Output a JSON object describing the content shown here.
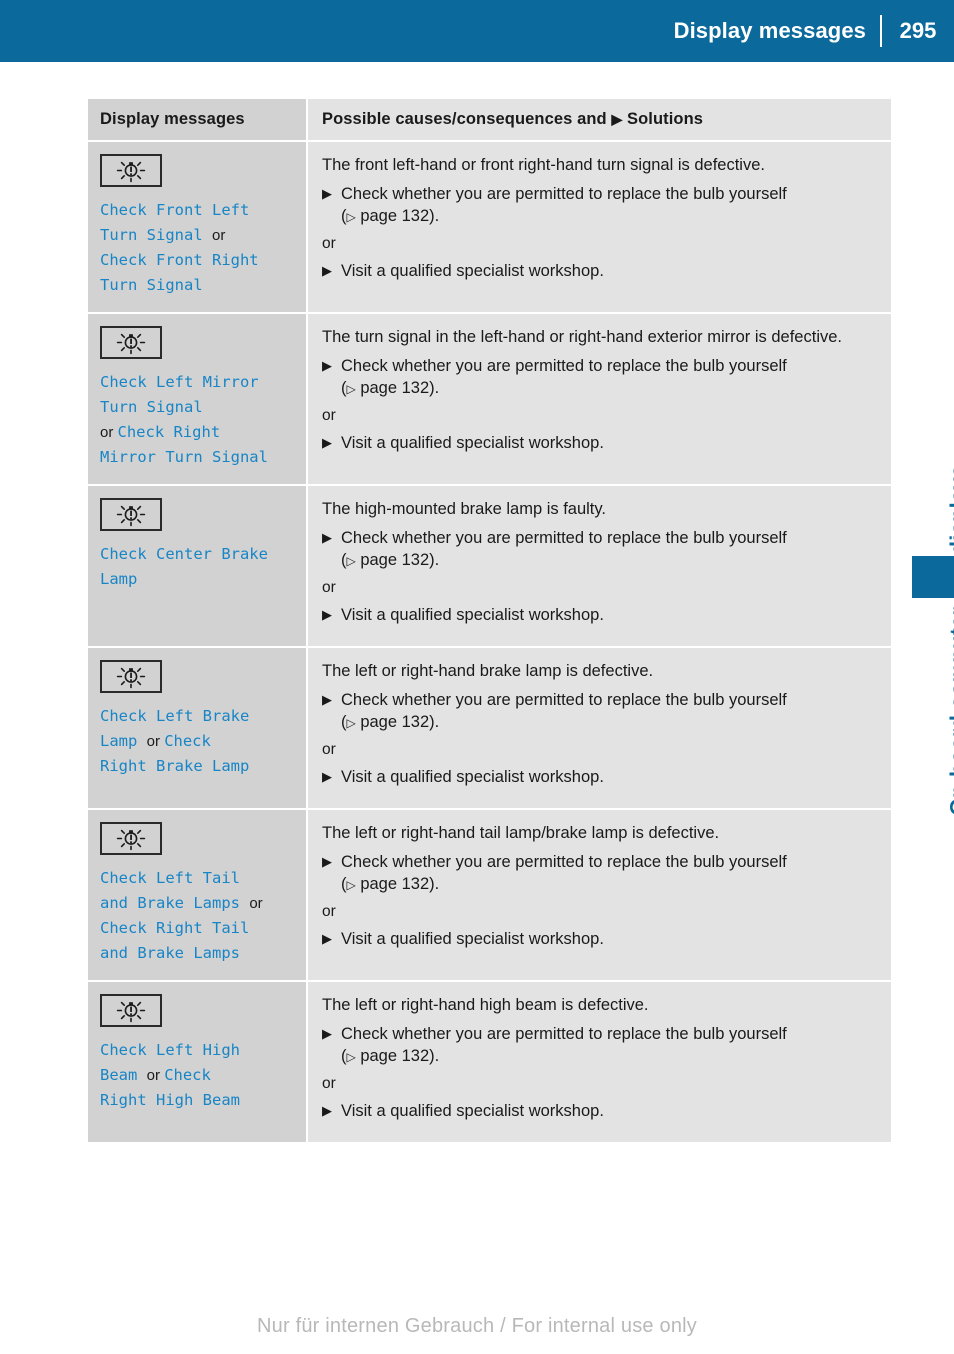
{
  "header": {
    "title": "Display messages",
    "page_number": "295"
  },
  "side_tab": {
    "label": "On-board computer and displays",
    "color": "#0b6a9b"
  },
  "table": {
    "columns": {
      "left_header": "Display messages",
      "right_header_before": "Possible causes/consequences and ",
      "right_header_arrow": "▶",
      "right_header_after": " Solutions"
    },
    "rows": [
      {
        "icon": "bulb-warning-icon",
        "message_lines": [
          {
            "text": "Check Front Left",
            "style": "code"
          },
          {
            "text": "Turn Signal ",
            "style": "code",
            "suffix": "or",
            "suffix_style": "plain"
          },
          {
            "text": " Check Front Right",
            "style": "code"
          },
          {
            "text": "Turn Signal",
            "style": "code"
          }
        ],
        "cause": "The front left-hand or front right-hand turn signal is defective.",
        "step1_main": "Check whether you are permitted to replace the bulb yourself",
        "step1_ref_open": "(",
        "step1_ref_arrow": "▷",
        "step1_ref_text": " page 132).",
        "or_label": "or",
        "step2_main": "Visit a qualified specialist workshop."
      },
      {
        "icon": "bulb-warning-icon",
        "message_lines": [
          {
            "text": "Check Left Mirror",
            "style": "code"
          },
          {
            "text": "Turn Signal",
            "style": "code"
          },
          {
            "text": "or ",
            "style": "plain",
            "suffix": "Check Right",
            "suffix_style": "code"
          },
          {
            "text": "Mirror Turn Signal",
            "style": "code"
          }
        ],
        "cause": "The turn signal in the left-hand or right-hand exterior mirror is defective.",
        "step1_main": "Check whether you are permitted to replace the bulb yourself",
        "step1_ref_open": "(",
        "step1_ref_arrow": "▷",
        "step1_ref_text": " page 132).",
        "or_label": "or",
        "step2_main": "Visit a qualified specialist workshop."
      },
      {
        "icon": "bulb-warning-icon",
        "message_lines": [
          {
            "text": "Check Center Brake",
            "style": "code"
          },
          {
            "text": "Lamp",
            "style": "code"
          }
        ],
        "cause": "The high-mounted brake lamp is faulty.",
        "step1_main": "Check whether you are permitted to replace the bulb yourself",
        "step1_ref_open": "(",
        "step1_ref_arrow": "▷",
        "step1_ref_text": " page 132).",
        "or_label": "or",
        "step2_main": "Visit a qualified specialist workshop."
      },
      {
        "icon": "bulb-warning-icon",
        "message_lines": [
          {
            "text": "Check Left Brake",
            "style": "code"
          },
          {
            "text": "Lamp ",
            "style": "code",
            "suffix": "or ",
            "suffix_style": "plain",
            "suffix2": "Check",
            "suffix2_style": "code"
          },
          {
            "text": "Right Brake Lamp",
            "style": "code"
          }
        ],
        "cause": "The left or right-hand brake lamp is defective.",
        "step1_main": "Check whether you are permitted to replace the bulb yourself",
        "step1_ref_open": "(",
        "step1_ref_arrow": "▷",
        "step1_ref_text": " page 132).",
        "or_label": "or",
        "step2_main": "Visit a qualified specialist workshop."
      },
      {
        "icon": "bulb-warning-icon",
        "message_lines": [
          {
            "text": "Check Left Tail",
            "style": "code"
          },
          {
            "text": "and Brake Lamps ",
            "style": "code",
            "suffix": "or",
            "suffix_style": "plain"
          },
          {
            "text": "Check Right Tail",
            "style": "code"
          },
          {
            "text": "and Brake Lamps",
            "style": "code"
          }
        ],
        "cause": "The left or right-hand tail lamp/brake lamp is defective.",
        "step1_main": "Check whether you are permitted to replace the bulb yourself",
        "step1_ref_open": "(",
        "step1_ref_arrow": "▷",
        "step1_ref_text": " page 132).",
        "or_label": "or",
        "step2_main": "Visit a qualified specialist workshop."
      },
      {
        "icon": "bulb-warning-icon",
        "message_lines": [
          {
            "text": "Check Left High",
            "style": "code"
          },
          {
            "text": "Beam ",
            "style": "code",
            "suffix": "or ",
            "suffix_style": "plain",
            "suffix2": "Check",
            "suffix2_style": "code"
          },
          {
            "text": "Right High Beam",
            "style": "code"
          }
        ],
        "cause": "The left or right-hand high beam is defective.",
        "step1_main": "Check whether you are permitted to replace the bulb yourself",
        "step1_ref_open": "(",
        "step1_ref_arrow": "▷",
        "step1_ref_text": " page 132).",
        "or_label": "or",
        "step2_main": "Visit a qualified specialist workshop."
      }
    ]
  },
  "footer": {
    "watermark": "Nur für internen Gebrauch / For internal use only"
  },
  "colors": {
    "brand_blue": "#0b6a9b",
    "code_blue": "#1785c6",
    "cell_left_bg": "#d2d2d2",
    "cell_right_bg": "#e3e3e3"
  }
}
